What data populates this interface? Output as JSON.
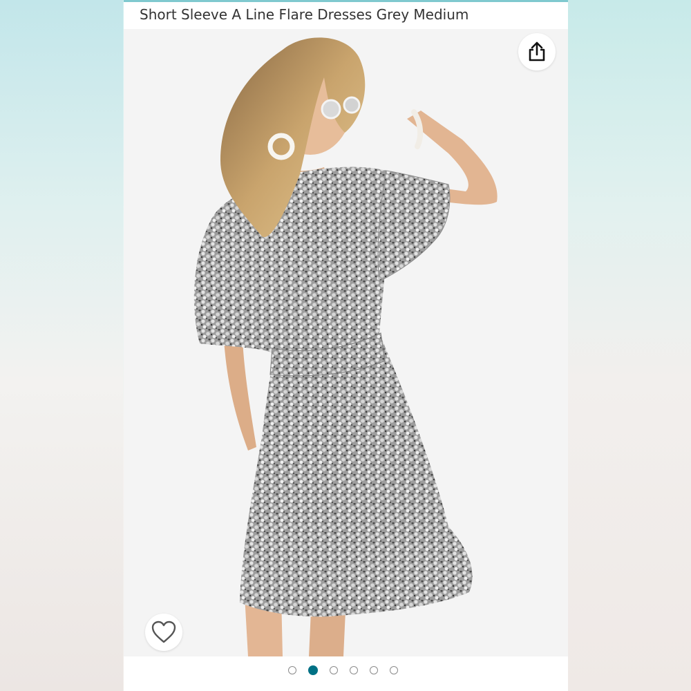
{
  "product": {
    "title": "Short Sleeve A Line Flare Dresses Grey Medium",
    "image_alt": "Woman wearing grey floral short sleeve A-line flare dress, back view"
  },
  "gallery": {
    "total_images": 6,
    "active_index": 1
  },
  "icons": {
    "share": "share-icon",
    "wishlist": "heart-icon"
  },
  "colors": {
    "accent_dot": "#007185",
    "top_border": "#7fc9cf"
  }
}
